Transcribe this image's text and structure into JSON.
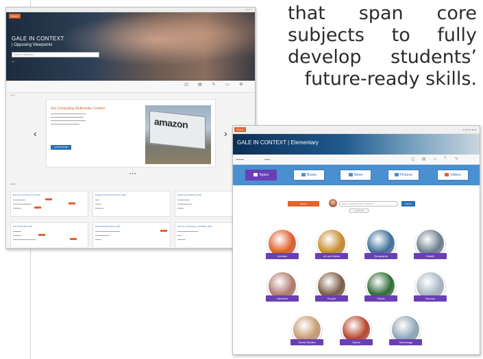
{
  "tagline": {
    "lines": [
      "that span core",
      "subjects to fully",
      "develop students’",
      "future-ready skills."
    ]
  },
  "screenshot1": {
    "logo": "GALE",
    "brand": "GALE IN CONTEXT",
    "subtitle": "| Opposing Viewpoints",
    "search_placeholder": "Search keyword",
    "carousel": {
      "title": "Get Compelling Multimedia Content",
      "button": "LEARN MORE",
      "image_text": "amazon"
    },
    "arrows": {
      "prev": "‹",
      "next": "›"
    },
    "dots": "● ● ●",
    "cards": [
      {
        "title": "Business and Economics (49)"
      },
      {
        "title": "Energy and the Environment (48)"
      },
      {
        "title": "Health and Medicine (101)"
      },
      {
        "title": "Law and Politics (98)"
      },
      {
        "title": "National/Global Topics (48)"
      },
      {
        "title": "Science, Technology, and Ethics (116)"
      }
    ]
  },
  "screenshot2": {
    "logo": "GALE",
    "brand": "GALE IN CONTEXT | Elementary",
    "tabs": [
      {
        "label": "Topics",
        "active": true
      },
      {
        "label": "Books",
        "active": false
      },
      {
        "label": "News",
        "active": false
      },
      {
        "label": "Pictures",
        "active": false
      },
      {
        "label": "Videos",
        "active": false
      }
    ],
    "filter_label": "Explore",
    "ask_placeholder": "Have a Question? Ask a Librarian!",
    "go_label": "Submit",
    "ask_sub": "Feedback",
    "topics": [
      {
        "label": "Animals",
        "color": "#e05b2a"
      },
      {
        "label": "Art and Music",
        "color": "#c78a2e"
      },
      {
        "label": "Geography",
        "color": "#3c6e9a"
      },
      {
        "label": "Health",
        "color": "#6c7d8d"
      },
      {
        "label": "Literature",
        "color": "#b07a6a"
      },
      {
        "label": "People",
        "color": "#7a5a45"
      },
      {
        "label": "Plants",
        "color": "#2e6b32"
      },
      {
        "label": "Science",
        "color": "#a9b7c3"
      },
      {
        "label": "Social Studies",
        "color": "#c79a6e"
      },
      {
        "label": "Sports",
        "color": "#b6452a"
      },
      {
        "label": "Technology",
        "color": "#8fa6b6"
      }
    ]
  }
}
